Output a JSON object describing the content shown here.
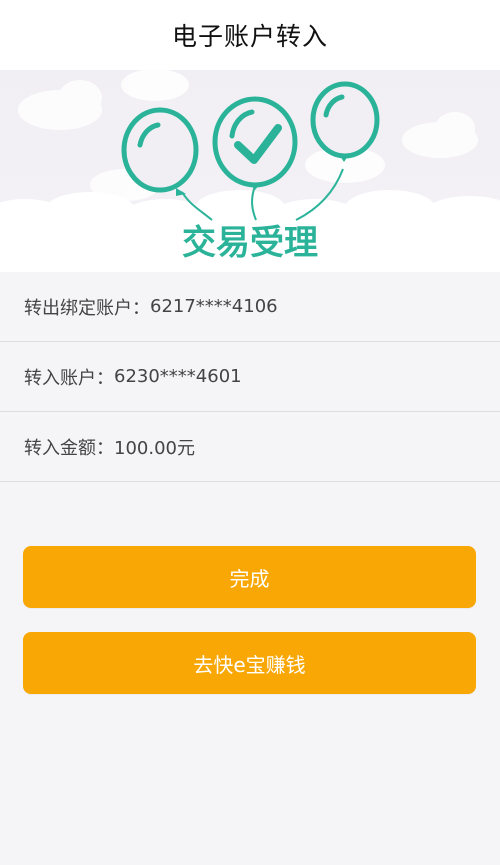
{
  "nav": {
    "title": "电子账户转入"
  },
  "banner": {
    "heading": "交易受理",
    "accent_color": "#2bb39a"
  },
  "details": [
    {
      "label": "转出绑定账户：",
      "value": "6217****4106"
    },
    {
      "label": "转入账户：",
      "value": "6230****4601"
    },
    {
      "label": "转入金额：",
      "value": "100.00元"
    }
  ],
  "buttons": {
    "done_label": "完成",
    "earn_label": "去快e宝赚钱",
    "color": "#f9a704"
  }
}
